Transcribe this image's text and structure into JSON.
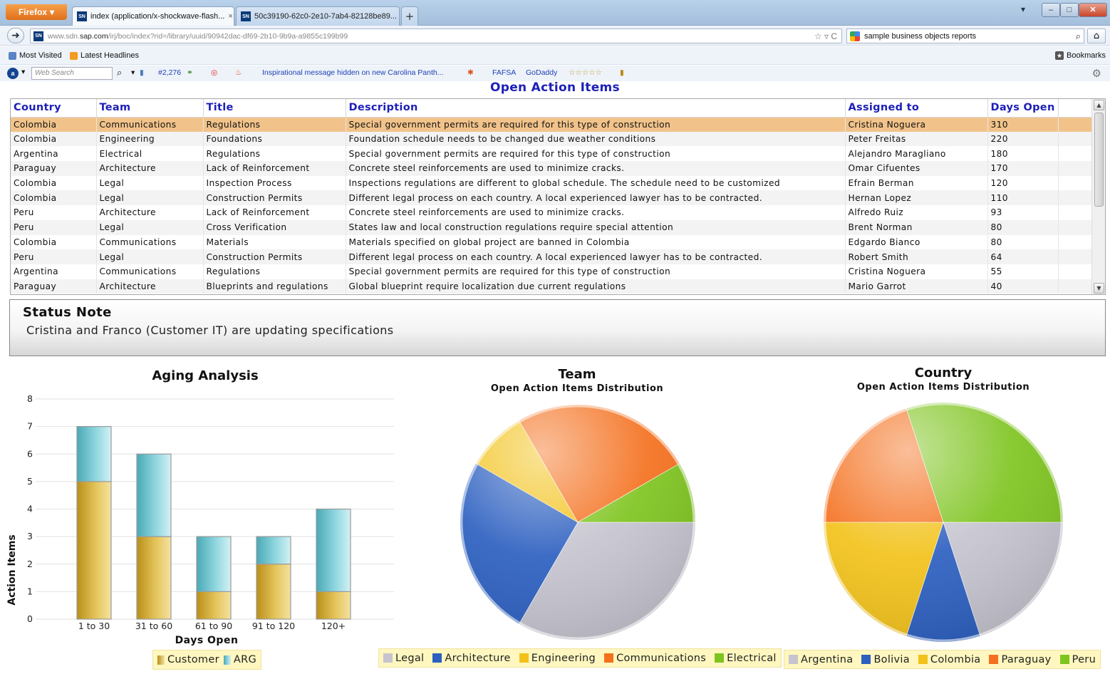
{
  "browser": {
    "menu_label": "Firefox",
    "tabs": [
      {
        "title": "index (application/x-shockwave-flash...",
        "favicon": "SN",
        "close": "×"
      },
      {
        "title": "50c39190-62c0-2e10-7ab4-82128be89...",
        "favicon": "SN",
        "close": "×"
      }
    ],
    "new_tab": "+",
    "window_buttons": {
      "dropdown": "▾",
      "minimize": "–",
      "maximize": "□",
      "close": "✕"
    },
    "url": {
      "prefix": "www.sdn.",
      "domain": "sap.com",
      "path": "/irj/boc/index?rid=/library/uuid/90942dac-df69-2b10-9b9a-a9855c199b99",
      "tail": "☆ ▿ C"
    },
    "search": {
      "value": "sample business objects reports"
    },
    "bookmarks": [
      {
        "label": "Most Visited"
      },
      {
        "label": "Latest Headlines"
      }
    ],
    "bookmarks_menu": "Bookmarks",
    "toolbar": {
      "web_search_placeholder": "Web Search",
      "rank": "#2,276",
      "news": "Inspirational message hidden on new Carolina Panth...",
      "fafsa": "FAFSA",
      "godaddy": "GoDaddy",
      "stars": "☆☆☆☆☆"
    }
  },
  "app": {
    "title": "Open Action Items",
    "table": {
      "columns": [
        "Country",
        "Team",
        "Title",
        "Description",
        "Assigned to",
        "Days Open"
      ],
      "rows": [
        [
          "Colombia",
          "Communications",
          "Regulations",
          "Special government permits are required for this type of construction",
          "Cristina Noguera",
          "310"
        ],
        [
          "Colombia",
          "Engineering",
          "Foundations",
          "Foundation schedule needs to be changed due weather conditions",
          "Peter Freitas",
          "220"
        ],
        [
          "Argentina",
          "Electrical",
          "Regulations",
          "Special government permits are required for this type of construction",
          "Alejandro Maragliano",
          "180"
        ],
        [
          "Paraguay",
          "Architecture",
          "Lack of Reinforcement",
          "Concrete steel reinforcements are used to minimize cracks.",
          "Omar Cifuentes",
          "170"
        ],
        [
          "Colombia",
          "Legal",
          "Inspection Process",
          "Inspections regulations are different to global schedule. The schedule need to be customized",
          "Efrain Berman",
          "120"
        ],
        [
          "Colombia",
          "Legal",
          "Construction Permits",
          "Different legal process on each country. A local experienced lawyer has to be contracted.",
          "Hernan Lopez",
          "110"
        ],
        [
          "Peru",
          "Architecture",
          "Lack of Reinforcement",
          "Concrete steel reinforcements are used to minimize cracks.",
          "Alfredo Ruiz",
          "93"
        ],
        [
          "Peru",
          "Legal",
          "Cross Verification",
          "States law and local construction regulations require special attention",
          "Brent Norman",
          "80"
        ],
        [
          "Colombia",
          "Communications",
          "Materials",
          "Materials specified on global project are banned in Colombia",
          "Edgardo Bianco",
          "80"
        ],
        [
          "Peru",
          "Legal",
          "Construction Permits",
          "Different legal process on each country. A local experienced lawyer has to be contracted.",
          "Robert Smith",
          "64"
        ],
        [
          "Argentina",
          "Communications",
          "Regulations",
          "Special government permits are required for this type of construction",
          "Cristina Noguera",
          "55"
        ],
        [
          "Paraguay",
          "Architecture",
          "Blueprints and regulations",
          "Global blueprint require localization due current regulations",
          "Mario Garrot",
          "40"
        ]
      ],
      "selected_row": 0
    },
    "status": {
      "title": "Status Note",
      "text": "Cristina and Franco (Customer IT) are updating specifications"
    }
  },
  "chart_data": [
    {
      "type": "bar",
      "stacked": true,
      "title": "Aging Analysis",
      "xlabel": "Days Open",
      "ylabel": "Action Items",
      "categories": [
        "1 to 30",
        "31 to 60",
        "61 to 90",
        "91 to 120",
        "120+"
      ],
      "series": [
        {
          "name": "Customer",
          "values": [
            5,
            3,
            1,
            2,
            1
          ],
          "color": "#d6ad2c"
        },
        {
          "name": "ARG",
          "values": [
            2,
            3,
            2,
            1,
            3
          ],
          "color": "#6cc6d0"
        }
      ],
      "ylim": [
        0,
        8
      ],
      "yticks": [
        "0",
        "1",
        "2",
        "3",
        "4",
        "5",
        "6",
        "7",
        "8"
      ],
      "grid": true,
      "legend": "bottom"
    },
    {
      "type": "pie",
      "title": "Team",
      "subtitle": "Open Action Items Distribution",
      "labels": [
        "Legal",
        "Architecture",
        "Engineering",
        "Communications",
        "Electrical"
      ],
      "values": [
        4,
        3,
        1,
        3,
        1
      ],
      "colors": [
        "#c5c4cf",
        "#2c5fc0",
        "#f2c21a",
        "#f4701e",
        "#7ec41f"
      ],
      "legend": "bottom"
    },
    {
      "type": "pie",
      "title": "Country",
      "subtitle": "Open Action Items Distribution",
      "labels": [
        "Argentina",
        "Bolivia",
        "Colombia",
        "Paraguay",
        "Peru"
      ],
      "values": [
        2,
        1,
        2,
        2,
        3
      ],
      "colors": [
        "#c5c4cf",
        "#2c5fc0",
        "#f2c21a",
        "#f4701e",
        "#7ec41f"
      ],
      "legend": "bottom"
    }
  ]
}
